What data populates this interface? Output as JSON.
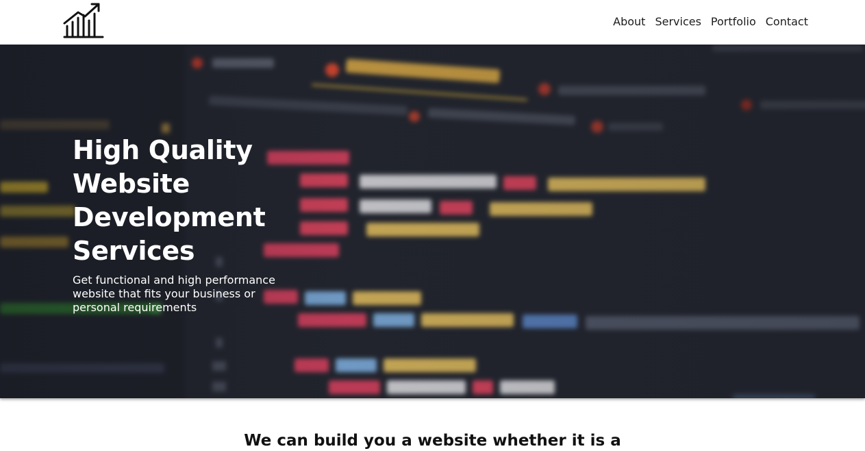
{
  "header": {
    "logo_icon": "chart-growth-icon",
    "nav": [
      {
        "label": "About"
      },
      {
        "label": "Services"
      },
      {
        "label": "Portfolio"
      },
      {
        "label": "Contact"
      }
    ]
  },
  "hero": {
    "title": "High Quality Website Development Services",
    "subtitle": "Get functional and high performance website that fits your business or personal requirements",
    "background": "blurred-code-editor-image"
  },
  "section": {
    "heading": "We can build you a website whether it is a"
  },
  "colors": {
    "header_bg": "#ffffff",
    "nav_text": "#1c1c1c",
    "hero_text": "#ffffff",
    "code_keyword": "#e8a0ff",
    "code_string": "#f0c674"
  }
}
